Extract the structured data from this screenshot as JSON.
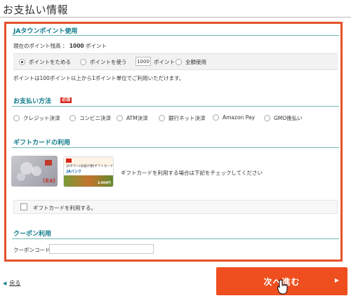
{
  "page": {
    "title": "お支払い情報"
  },
  "points": {
    "heading": "JAタウンポイント使用",
    "balance_label": "現在のポイント残高 ：",
    "balance_value": "1000",
    "balance_unit": "ポイント",
    "options": [
      {
        "label": "ポイントをためる",
        "selected": true
      },
      {
        "label": "ポイントを使う",
        "selected": false
      },
      {
        "label": "全額使用",
        "selected": false
      }
    ],
    "amount_value": "1000",
    "amount_unit": "ポイント",
    "note": "ポイントは100ポイント以上から1ポイント単位でご利用いただけます。"
  },
  "payment": {
    "heading": "お支払い方法",
    "required_badge": "必須",
    "methods": [
      "クレジット決済",
      "コンビニ決済",
      "ATM決済",
      "銀行ネット決済",
      "Amazon Pay",
      "GMO後払い"
    ]
  },
  "giftcard": {
    "heading": "ギフトカードの利用",
    "card1_text": "【見本】",
    "card2_title": "JAタウン(お届け便)ギフトカード",
    "card2_brand": "JAバンク",
    "card2_amount": "3,000円",
    "info": "ギフトカードを利用する場合は下記をチェックしてください",
    "checkbox_label": "ギフトカードを利用する。"
  },
  "coupon": {
    "heading": "クーポン利用",
    "code_label": "クーポンコード：",
    "code_value": ""
  },
  "nav": {
    "back_label": "戻る",
    "next_label": "次へ進む"
  },
  "colors": {
    "accent": "#e4522b",
    "button": "#ef4f1e",
    "teal": "#0e7a8a",
    "required": "#d9261c"
  }
}
